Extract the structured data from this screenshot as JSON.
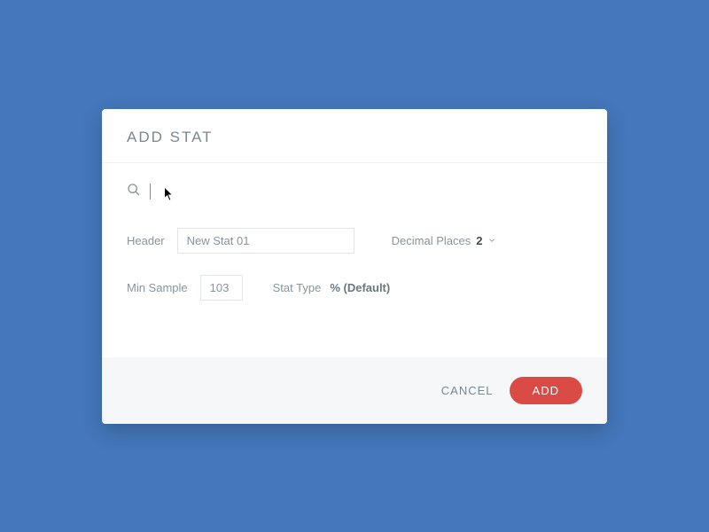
{
  "dialog": {
    "title": "ADD STAT"
  },
  "search": {
    "value": "",
    "placeholder": ""
  },
  "form": {
    "header_label": "Header",
    "header_value": "New Stat 01",
    "decimal_label": "Decimal Places",
    "decimal_value": "2",
    "min_sample_label": "Min Sample",
    "min_sample_value": "103",
    "stat_type_label": "Stat Type",
    "stat_type_value": "% (Default)"
  },
  "footer": {
    "cancel_label": "CANCEL",
    "add_label": "ADD"
  }
}
